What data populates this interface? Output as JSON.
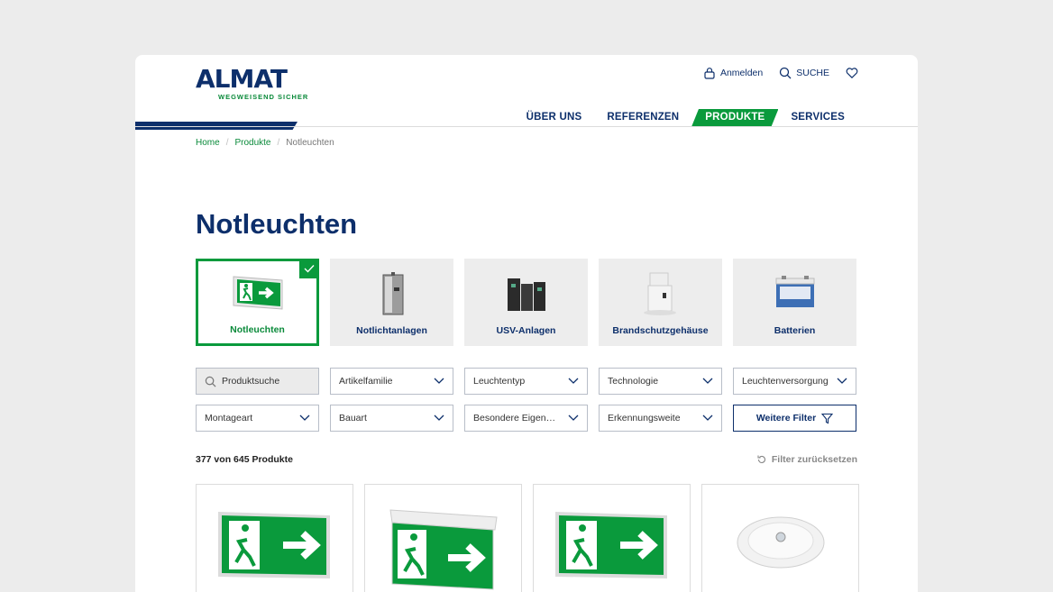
{
  "logo": {
    "main": "ALMAT",
    "sub": "WEGWEISEND SICHER"
  },
  "topnav": {
    "login": "Anmelden",
    "search": "SUCHE"
  },
  "mainnav": [
    {
      "label": "ÜBER UNS",
      "active": false
    },
    {
      "label": "REFERENZEN",
      "active": false
    },
    {
      "label": "PRODUKTE",
      "active": true
    },
    {
      "label": "SERVICES",
      "active": false
    }
  ],
  "breadcrumb": {
    "home": "Home",
    "products": "Produkte",
    "current": "Notleuchten"
  },
  "page_title": "Notleuchten",
  "categories": [
    {
      "label": "Notleuchten",
      "active": true,
      "icon": "exit-sign-icon"
    },
    {
      "label": "Notlichtanlagen",
      "active": false,
      "icon": "cabinet-icon"
    },
    {
      "label": "USV-Anlagen",
      "active": false,
      "icon": "ups-icon"
    },
    {
      "label": "Brandschutzgehäuse",
      "active": false,
      "icon": "enclosure-icon"
    },
    {
      "label": "Batterien",
      "active": false,
      "icon": "battery-icon"
    }
  ],
  "filters": {
    "search_placeholder": "Produktsuche",
    "row1": [
      "Artikelfamilie",
      "Leuchtentyp",
      "Technologie",
      "Leuchtenversorgung"
    ],
    "row2": [
      "Montageart",
      "Bauart",
      "Besondere Eigenschaften",
      "Erkennungsweite"
    ],
    "more": "Weitere Filter"
  },
  "results": {
    "count": "377 von 645 Produkte",
    "reset": "Filter zurücksetzen"
  },
  "colors": {
    "navy": "#0d2f6b",
    "green": "#0a9a3c"
  }
}
